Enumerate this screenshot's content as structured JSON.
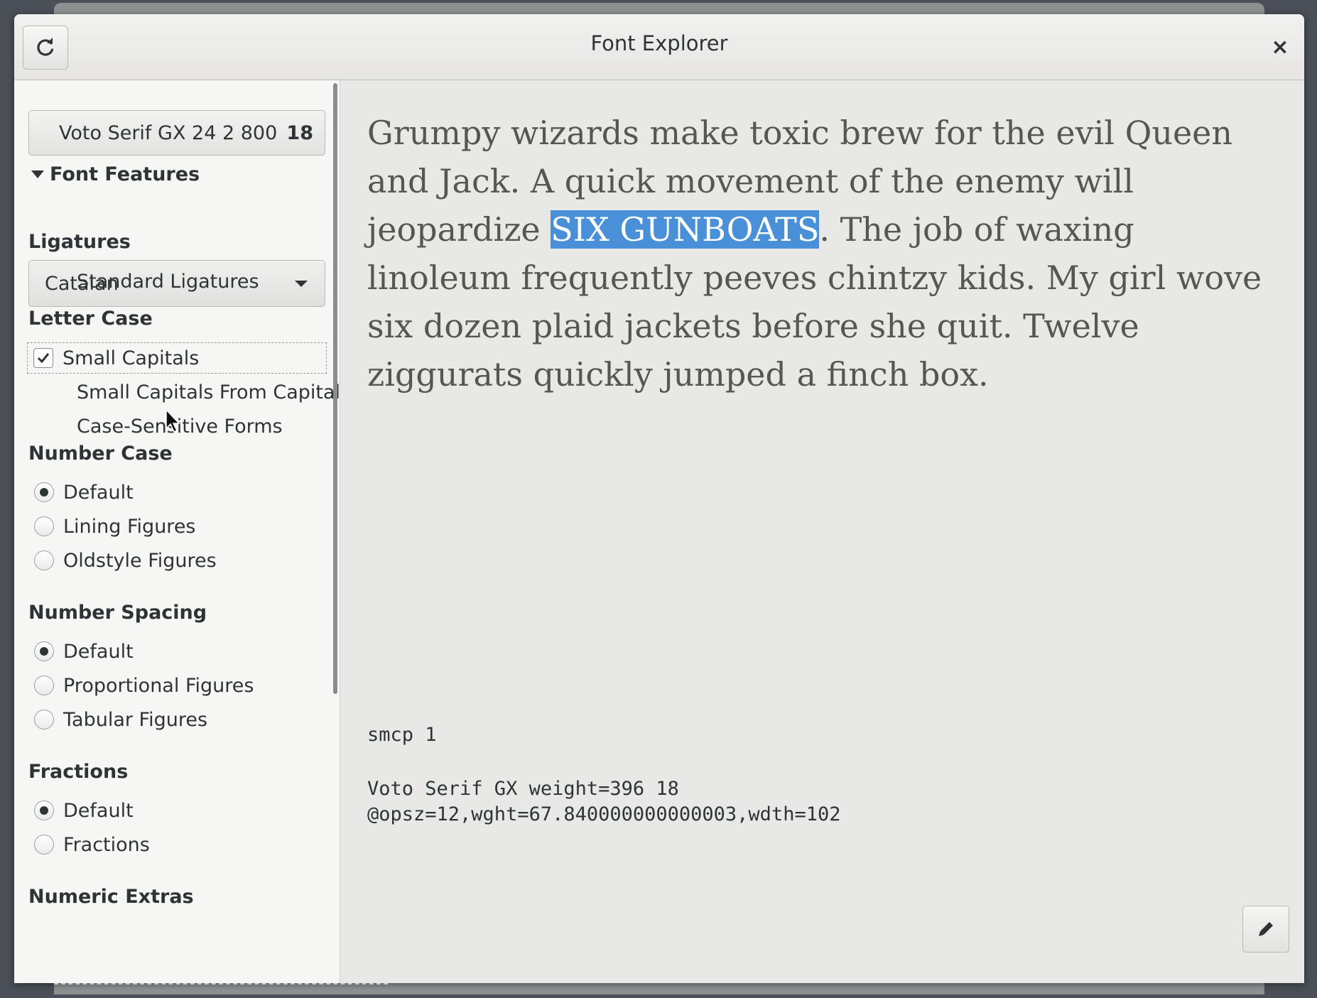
{
  "window": {
    "title": "Font Explorer",
    "close_glyph": "×",
    "refresh_icon": "refresh-icon",
    "close_icon": "close-icon"
  },
  "sidebar": {
    "font_button": {
      "name": "Voto Serif GX 24 2 800",
      "size": "18"
    },
    "font_features_label": "Font Features",
    "language_combo": {
      "value": "Catalan"
    },
    "ligatures": {
      "heading": "Ligatures",
      "items": [
        {
          "label": "Standard Ligatures"
        }
      ]
    },
    "letter_case": {
      "heading": "Letter Case",
      "items": [
        {
          "label": "Small Capitals",
          "checked": true
        },
        {
          "label": "Small Capitals From Capitals"
        },
        {
          "label": "Case-Sensitive Forms"
        }
      ]
    },
    "number_case": {
      "heading": "Number Case",
      "options": [
        "Default",
        "Lining Figures",
        "Oldstyle Figures"
      ],
      "selected": "Default"
    },
    "number_spacing": {
      "heading": "Number Spacing",
      "options": [
        "Default",
        "Proportional Figures",
        "Tabular Figures"
      ],
      "selected": "Default"
    },
    "fractions": {
      "heading": "Fractions",
      "options": [
        "Default",
        "Fractions"
      ],
      "selected": "Default"
    },
    "numeric_extras": {
      "heading": "Numeric Extras"
    }
  },
  "main": {
    "sample": {
      "before": "Grumpy wizards make toxic brew for the evil Queen and Jack. A quick movement of the enemy will jeopardize ",
      "highlight": "SIX GUNBOATS",
      "after": ". The job of waxing linoleum frequently peeves chintzy kids. My girl wove six dozen plaid jackets before she quit. Twelve ziggurats quickly jumped a finch box."
    },
    "features_line": "smcp 1",
    "font_line1": "Voto Serif GX weight=396 18",
    "font_line2": "@opsz=12,wght=67.840000000000003,wdth=102",
    "edit_icon": "pencil-icon"
  },
  "colors": {
    "selection": "#4a90d9",
    "sidebar_bg": "#f6f6f5",
    "main_bg": "#e8e8e7"
  }
}
